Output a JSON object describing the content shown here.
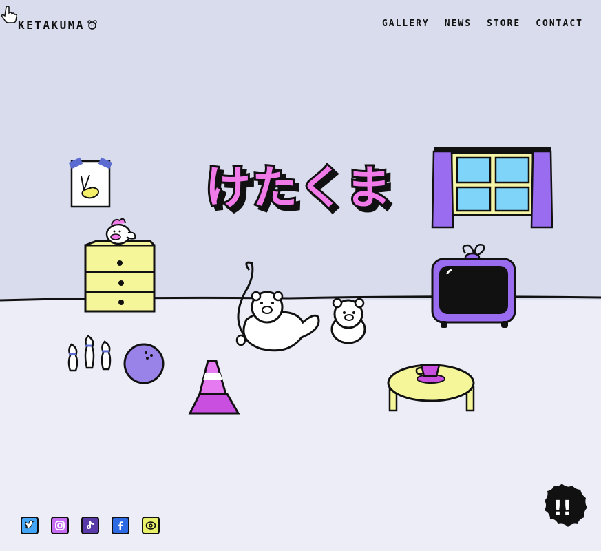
{
  "header": {
    "logo_text": "KETAKUMA",
    "nav": [
      {
        "label": "GALLERY"
      },
      {
        "label": "NEWS"
      },
      {
        "label": "STORE"
      },
      {
        "label": "CONTACT"
      }
    ]
  },
  "hero": {
    "title": "けたくま"
  },
  "social": {
    "links": [
      {
        "icon": "twitter-icon",
        "color": "#42a5f5"
      },
      {
        "icon": "instagram-icon",
        "color": "#c66cf2"
      },
      {
        "icon": "tiktok-icon",
        "color": "#5a3aa8"
      },
      {
        "icon": "facebook-icon",
        "color": "#2d6ae3"
      },
      {
        "icon": "line-icon",
        "color": "#e9f06a"
      }
    ]
  },
  "floating_button": {
    "icon": "exclamation-icon",
    "label": "!!"
  },
  "colors": {
    "wall": "#d9dced",
    "floor": "#ecedf7",
    "title_pink": "#f07ae8",
    "accent_purple": "#9a6cf0",
    "accent_yellow": "#f5f59a",
    "window_blue": "#7fd4fa"
  }
}
